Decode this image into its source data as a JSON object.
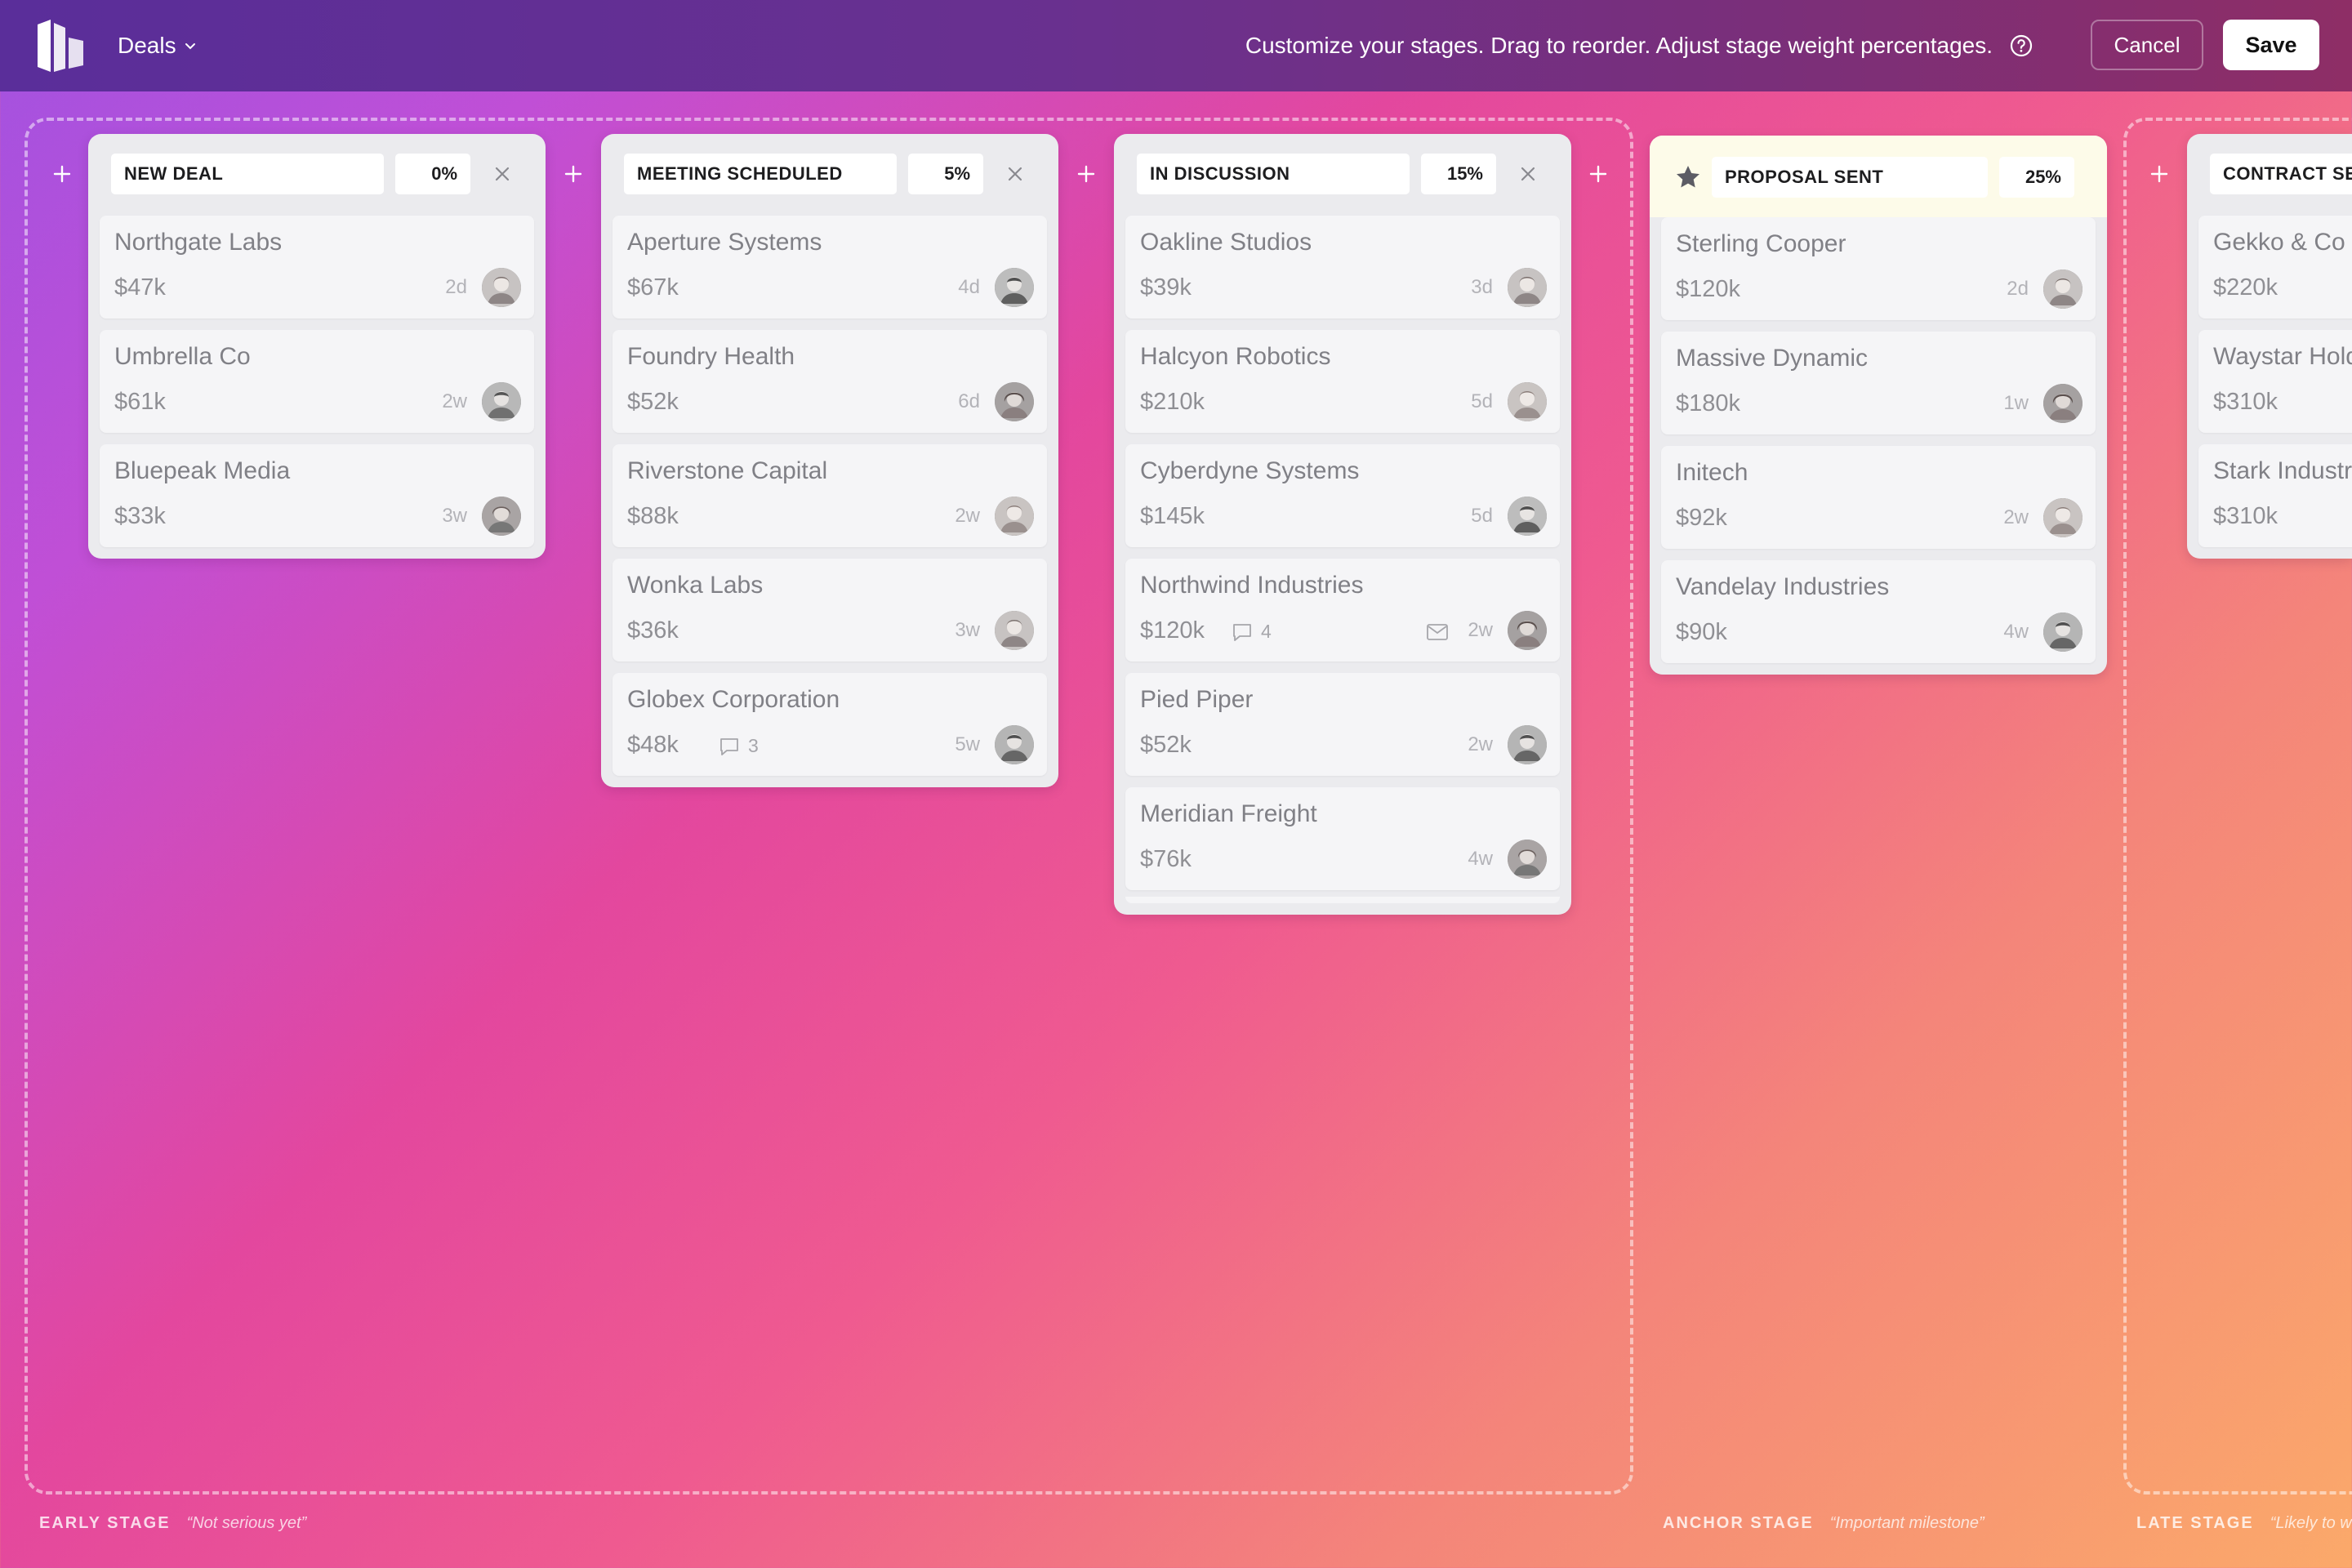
{
  "header": {
    "menu_label": "Deals",
    "hint": "Customize your stages. Drag to reorder. Adjust stage weight percentages.",
    "cancel_label": "Cancel",
    "save_label": "Save"
  },
  "groups": [
    {
      "name": "EARLY STAGE",
      "quote": "“Not serious yet”"
    },
    {
      "name": "ANCHOR STAGE",
      "quote": "“Important milestone”"
    },
    {
      "name": "LATE STAGE",
      "quote": "“Likely to win”"
    }
  ],
  "stages": [
    {
      "name": "NEW DEAL",
      "weight": "0%",
      "deals": [
        {
          "company": "Northgate Labs",
          "amount": "$47k",
          "age": "2d"
        },
        {
          "company": "Umbrella Co",
          "amount": "$61k",
          "age": "2w"
        },
        {
          "company": "Bluepeak Media",
          "amount": "$33k",
          "age": "3w"
        }
      ]
    },
    {
      "name": "MEETING SCHEDULED",
      "weight": "5%",
      "deals": [
        {
          "company": "Aperture Systems",
          "amount": "$67k",
          "age": "4d"
        },
        {
          "company": "Foundry Health",
          "amount": "$52k",
          "age": "6d"
        },
        {
          "company": "Riverstone Capital",
          "amount": "$88k",
          "age": "2w"
        },
        {
          "company": "Wonka Labs",
          "amount": "$36k",
          "age": "3w"
        },
        {
          "company": "Globex Corporation",
          "amount": "$48k",
          "age": "5w",
          "comments": "3"
        }
      ]
    },
    {
      "name": "IN DISCUSSION",
      "weight": "15%",
      "deals": [
        {
          "company": "Oakline Studios",
          "amount": "$39k",
          "age": "3d"
        },
        {
          "company": "Halcyon Robotics",
          "amount": "$210k",
          "age": "5d"
        },
        {
          "company": "Cyberdyne Systems",
          "amount": "$145k",
          "age": "5d"
        },
        {
          "company": "Northwind Industries",
          "amount": "$120k",
          "age": "2w",
          "comments": "4"
        },
        {
          "company": "Pied Piper",
          "amount": "$52k",
          "age": "2w"
        },
        {
          "company": "Meridian Freight",
          "amount": "$76k",
          "age": "4w"
        }
      ]
    },
    {
      "name": "PROPOSAL SENT",
      "weight": "25%",
      "deals": [
        {
          "company": "Sterling Cooper",
          "amount": "$120k",
          "age": "2d"
        },
        {
          "company": "Massive Dynamic",
          "amount": "$180k",
          "age": "1w"
        },
        {
          "company": "Initech",
          "amount": "$92k",
          "age": "2w"
        },
        {
          "company": "Vandelay Industries",
          "amount": "$90k",
          "age": "4w"
        }
      ]
    },
    {
      "name": "CONTRACT SENT",
      "weight": "",
      "deals": [
        {
          "company": "Gekko & Co",
          "amount": "$220k",
          "age": ""
        },
        {
          "company": "Waystar Holdings",
          "amount": "$310k",
          "age": ""
        },
        {
          "company": "Stark Industries",
          "amount": "$310k",
          "age": ""
        }
      ]
    }
  ]
}
